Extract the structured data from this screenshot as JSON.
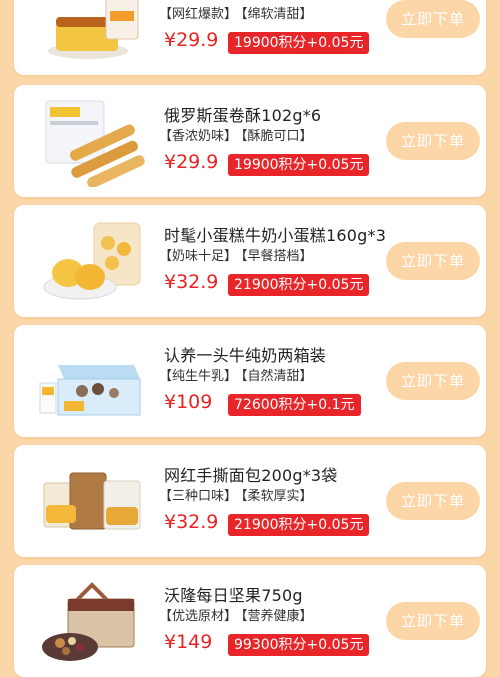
{
  "currency": "¥",
  "buy_label": "立即下单",
  "colors": {
    "page_background": "#fbd6a6",
    "card_background": "#ffffff",
    "price_red": "#e82323",
    "points_badge": "#e8262a",
    "buy_button": "#fcd6a6"
  },
  "products": [
    {
      "name": "",
      "tag1": "【网红爆款】",
      "tag2": "【绵软清甜】",
      "price": "¥29.9",
      "points": "19900积分+0.05元",
      "image": "sponge-cake-icon"
    },
    {
      "name": "俄罗斯蛋卷酥102g*6",
      "tag1": "【香浓奶味】",
      "tag2": "【酥脆可口】",
      "price": "¥29.9",
      "points": "19900积分+0.05元",
      "image": "egg-roll-icon"
    },
    {
      "name": "时髦小蛋糕牛奶小蛋糕160g*3",
      "tag1": "【奶味十足】",
      "tag2": "【早餐搭档】",
      "price": "¥32.9",
      "points": "21900积分+0.05元",
      "image": "mini-cake-icon"
    },
    {
      "name": "认养一头牛纯奶两箱装",
      "tag1": "【纯生牛乳】",
      "tag2": "【自然清甜】",
      "price": "¥109",
      "points": "72600积分+0.1元",
      "image": "milk-box-icon"
    },
    {
      "name": "网红手撕面包200g*3袋",
      "tag1": "【三种口味】",
      "tag2": "【柔软厚实】",
      "price": "¥32.9",
      "points": "21900积分+0.05元",
      "image": "bread-bags-icon"
    },
    {
      "name": "沃隆每日坚果750g",
      "tag1": "【优选原材】",
      "tag2": "【营养健康】",
      "price": "¥149",
      "points": "99300积分+0.05元",
      "image": "nuts-gift-box-icon"
    }
  ]
}
